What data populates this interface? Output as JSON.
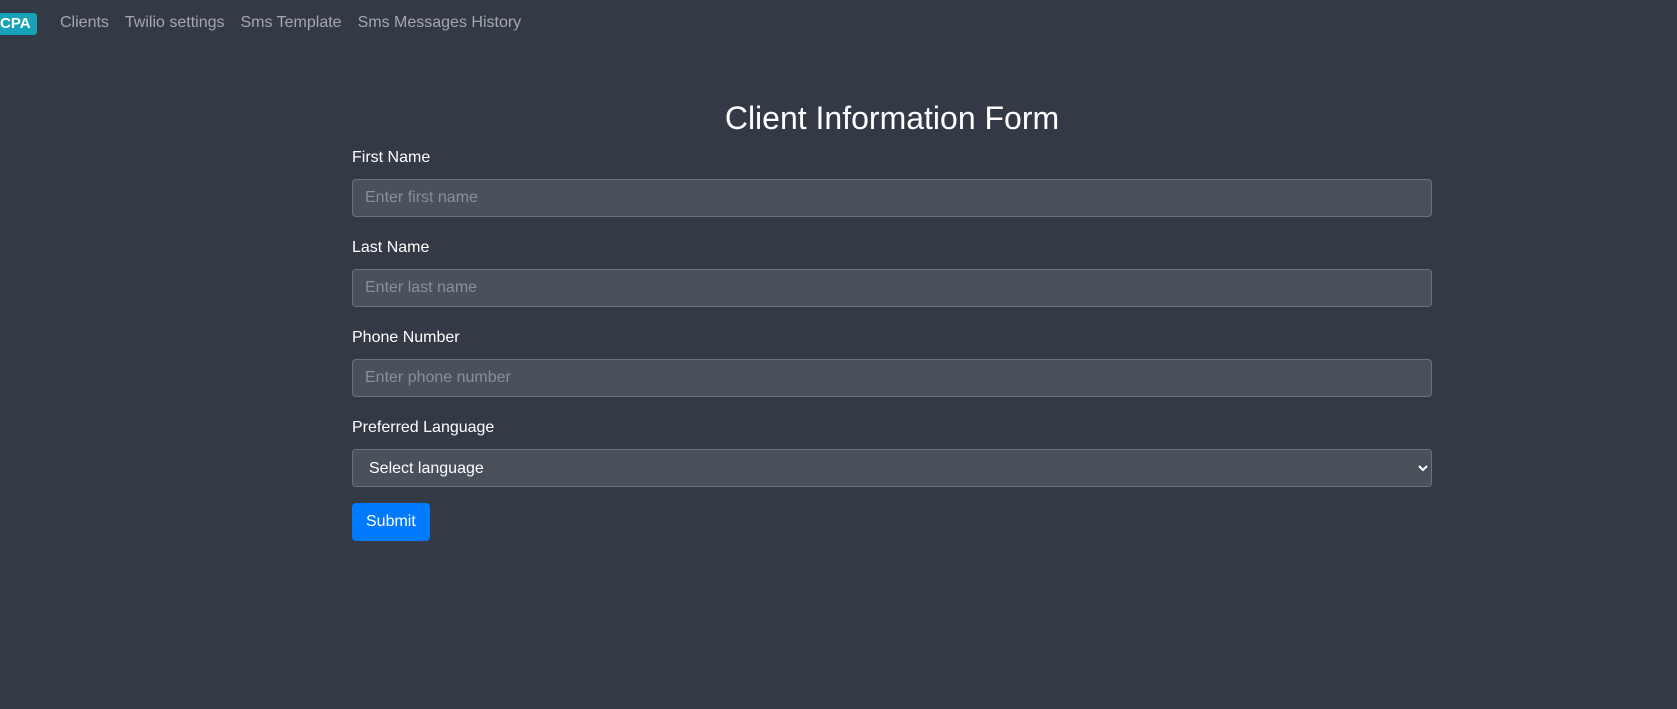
{
  "nav": {
    "brand": "CPA",
    "links": [
      {
        "label": "Clients"
      },
      {
        "label": "Twilio settings"
      },
      {
        "label": "Sms Template"
      },
      {
        "label": "Sms Messages History"
      }
    ]
  },
  "form": {
    "title": "Client Information Form",
    "first_name": {
      "label": "First Name",
      "placeholder": "Enter first name",
      "value": ""
    },
    "last_name": {
      "label": "Last Name",
      "placeholder": "Enter last name",
      "value": ""
    },
    "phone": {
      "label": "Phone Number",
      "placeholder": "Enter phone number",
      "value": ""
    },
    "language": {
      "label": "Preferred Language",
      "selected": "Select language"
    },
    "submit_label": "Submit"
  },
  "colors": {
    "background": "#343a45",
    "brand_badge": "#17a2b8",
    "primary": "#007bff",
    "input_bg": "#4a515b"
  }
}
